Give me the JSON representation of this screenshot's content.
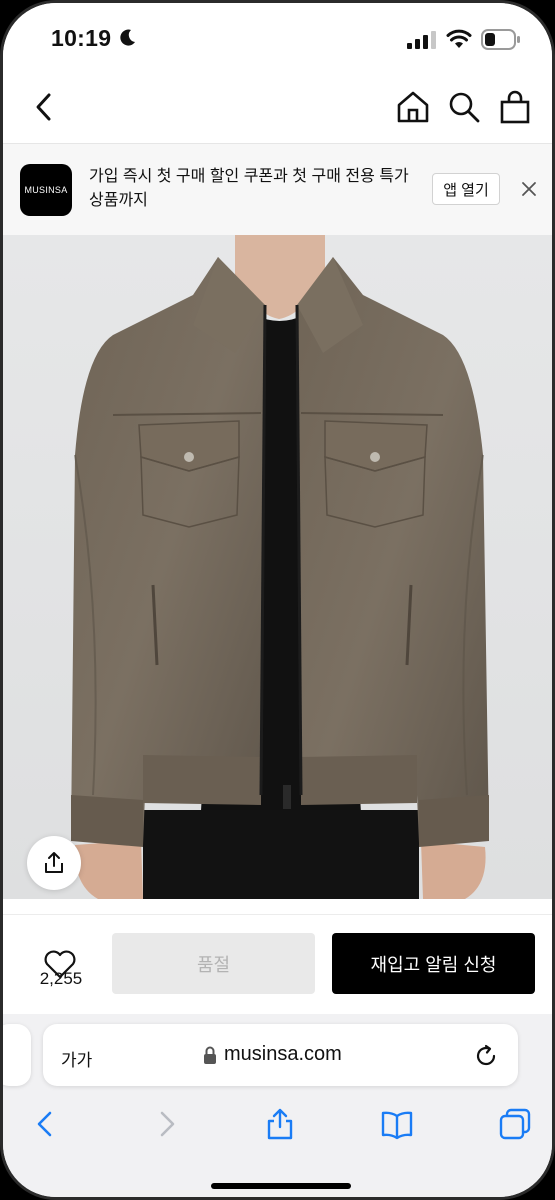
{
  "status_bar": {
    "time": "10:19"
  },
  "header": {
    "icons": [
      "back-icon",
      "home-icon",
      "search-icon",
      "bag-icon"
    ]
  },
  "app_banner": {
    "logo_text": "MUSINSA",
    "message": "가입 즉시 첫 구매 할인 쿠폰과 첫 구매 전용 특가 상품까지",
    "open_button": "앱 열기"
  },
  "product": {
    "like_count": "2,255",
    "sold_out_label": "품절",
    "restock_label": "재입고 알림 신청"
  },
  "browser": {
    "text_size_label": "가가",
    "domain": "musinsa.com"
  },
  "colors": {
    "accent": "#000000",
    "disabled_bg": "#e9e9e9",
    "safari_blue": "#1a7cf5"
  }
}
